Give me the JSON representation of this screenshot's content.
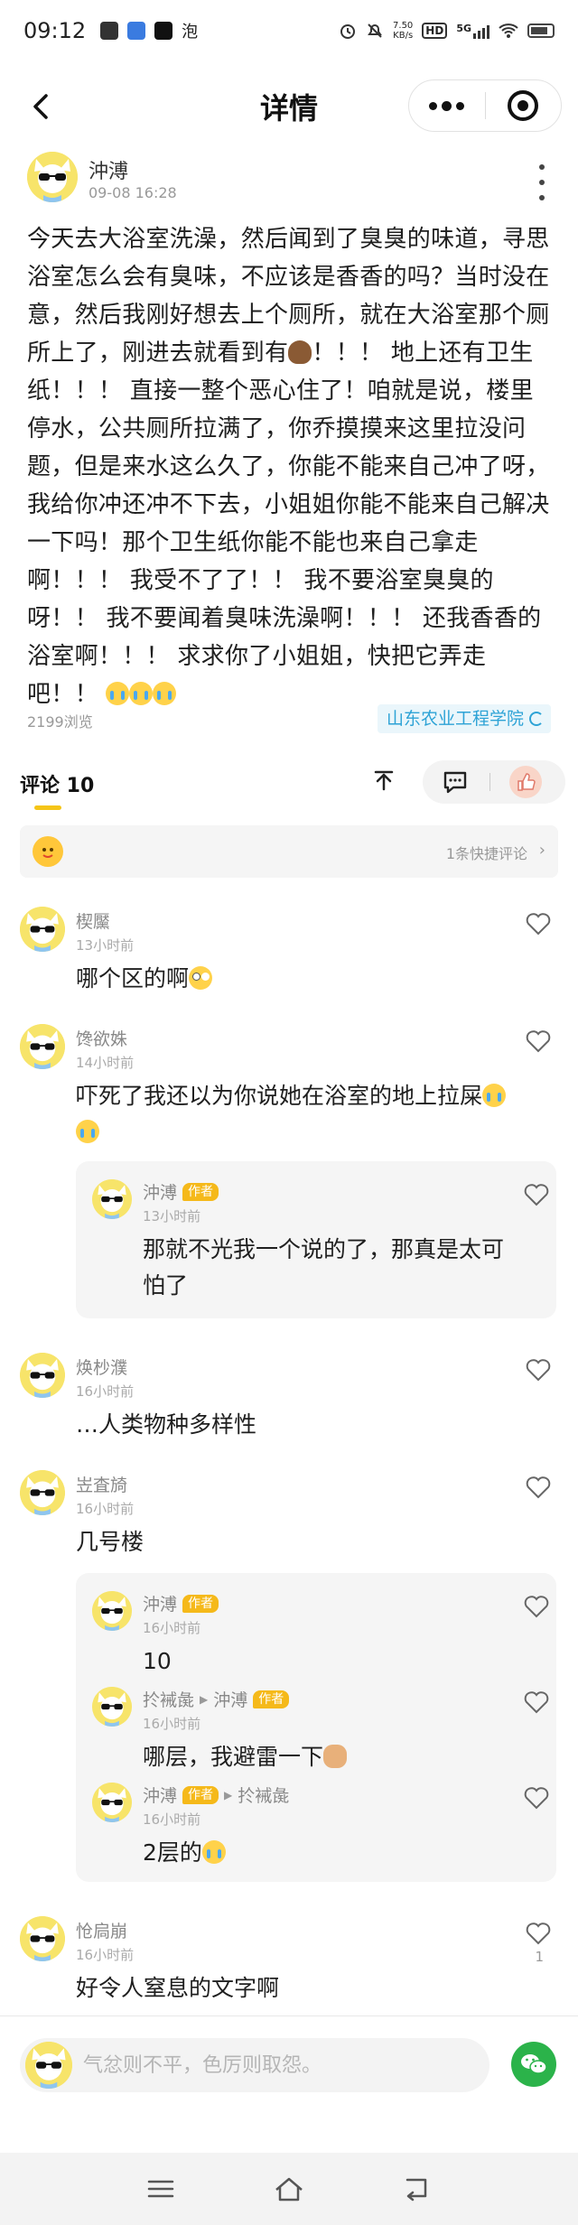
{
  "status_bar": {
    "time": "09:12",
    "notif_text_icon": "泡",
    "net_speed_value": "7.50",
    "net_speed_unit": "KB/s",
    "hd_label": "HD",
    "signal_label": "5G"
  },
  "nav": {
    "title": "详情"
  },
  "post": {
    "author": "沖溥",
    "time": "09-08 16:28",
    "body_part1": "今天去大浴室洗澡，然后闻到了臭臭的味道，寻思浴室怎么会有臭味，不应该是香香的吗？当时没在意，然后我刚好想去上个厕所，就在大浴室那个厕所上了，刚进去就看到有",
    "body_part2": "！！！ 地上还有卫生纸！！！ 直接一整个恶心住了！咱就是说，楼里停水，公共厕所拉满了，你乔摸摸来这里拉没问题，但是来水这么久了，你能不能来自己冲了呀，我给你冲还冲不下去，小姐姐你能不能来自己解决一下吗！那个卫生纸你能不能也来自己拿走啊！！！ 我受不了了！！ 我不要浴室臭臭的呀！！ 我不要闻着臭味洗澡啊！！！ 还我香香的浴室啊！！！ 求求你了小姐姐，快把它弄走吧！！",
    "views": "2199浏览",
    "school": "山东农业工程学院"
  },
  "comments_section": {
    "tab_label": "评论 10",
    "quick_comment_text": "1条快捷评论",
    "quick_comment_arrow": "›"
  },
  "comments": [
    {
      "name": "楔黶",
      "time": "13小时前",
      "text": "哪个区的啊"
    },
    {
      "name": "馋欲姝",
      "time": "14小时前",
      "text": "吓死了我还以为你说她在浴室的地上拉屎",
      "replies": [
        {
          "name": "沖溥",
          "tag": "作者",
          "time": "13小时前",
          "text": "那就不光我一个说的了，那真是太可怕了"
        }
      ]
    },
    {
      "name": "焕杪濮",
      "time": "16小时前",
      "text": "…人类物种多样性"
    },
    {
      "name": "岦査旑",
      "time": "16小时前",
      "text": "几号楼",
      "replies": [
        {
          "name": "沖溥",
          "tag": "作者",
          "time": "16小时前",
          "text": "10"
        },
        {
          "name": "扵裓彘",
          "reply_to": "沖溥",
          "reply_to_tag": "作者",
          "time": "16小时前",
          "text": "哪层，我避雷一下"
        },
        {
          "name": "沖溥",
          "tag": "作者",
          "reply_to": "扵裓彘",
          "time": "16小时前",
          "text": "2层的"
        }
      ]
    },
    {
      "name": "怆扃崩",
      "time": "16小时前",
      "text": "好令人窒息的文字啊",
      "likes": "1"
    }
  ],
  "input": {
    "placeholder": "气忿则不平，色厉则取怨。"
  },
  "icons": {
    "back": "chevron-left-icon",
    "more": "more-dots-icon",
    "close": "mini-program-close-icon",
    "share": "share-icon",
    "comment": "comment-icon",
    "like": "thumb-up-icon",
    "heart": "heart-outline-icon",
    "wechat": "wechat-icon"
  },
  "colors": {
    "accent_yellow": "#f5c518",
    "author_tag": "#f5b91a",
    "school_text": "#2ea3d6",
    "wechat_green": "#2bb34a"
  }
}
